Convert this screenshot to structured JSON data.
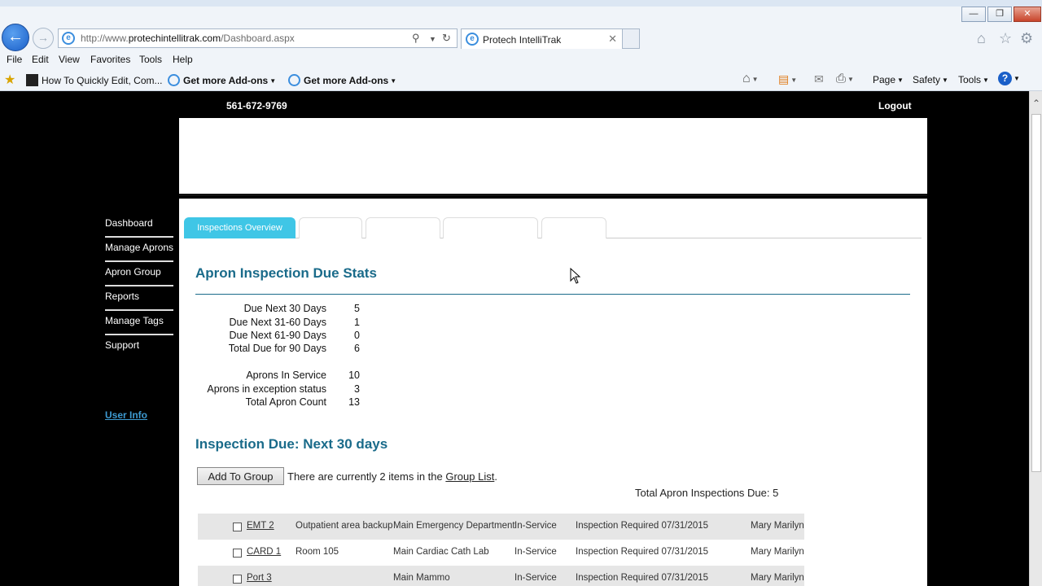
{
  "browser": {
    "url_prefix": "http://www.",
    "url_host": "protechintellitrak.com",
    "url_path": "/Dashboard.aspx",
    "tab_title": "Protech IntelliTrak",
    "menu": [
      "File",
      "Edit",
      "View",
      "Favorites",
      "Tools",
      "Help"
    ],
    "favorites": [
      {
        "label": "How To Quickly Edit, Com...",
        "bold": false
      },
      {
        "label": "Get more Add-ons",
        "bold": true
      },
      {
        "label": "Get more Add-ons",
        "bold": true
      }
    ],
    "commands": [
      "Page",
      "Safety",
      "Tools"
    ]
  },
  "header": {
    "phone": "561-672-9769",
    "logout": "Logout"
  },
  "sidebar": {
    "items": [
      "Dashboard",
      "Manage Aprons",
      "Apron Group",
      "Reports",
      "Manage Tags",
      "Support"
    ],
    "user_info": "User Info"
  },
  "tabs": {
    "active_label": "Inspections Overview"
  },
  "stats": {
    "title": "Apron Inspection Due Stats",
    "rows": [
      {
        "label": "Due Next 30 Days",
        "value": "5"
      },
      {
        "label": "Due Next 31-60 Days",
        "value": "1"
      },
      {
        "label": "Due Next 61-90 Days",
        "value": "0"
      },
      {
        "label": "Total Due for 90 Days",
        "value": "6"
      },
      {
        "label": "Aprons In Service",
        "value": "10"
      },
      {
        "label": "Aprons in exception status",
        "value": "3"
      },
      {
        "label": "Total Apron Count",
        "value": "13"
      }
    ]
  },
  "due": {
    "title": "Inspection Due: Next 30 days",
    "add_button": "Add To Group",
    "msg_prefix": "There are currently 2 items in the ",
    "msg_link": "Group List",
    "msg_suffix": ".",
    "total": "Total Apron Inspections Due: 5",
    "rows": [
      {
        "name": "EMT 2",
        "location": "Outpatient area backup",
        "department": "Main Emergency Department",
        "status": "In-Service",
        "inspection": "Inspection Required 07/31/2015",
        "person": "Mary Marilyn"
      },
      {
        "name": "CARD 1",
        "location": "Room 105",
        "department": "Main Cardiac Cath Lab",
        "status": "In-Service",
        "inspection": "Inspection Required 07/31/2015",
        "person": "Mary Marilyn"
      },
      {
        "name": "Port 3",
        "location": "",
        "department": "Main Mammo",
        "status": "In-Service",
        "inspection": "Inspection Required 07/31/2015",
        "person": "Mary Marilyn"
      }
    ]
  }
}
